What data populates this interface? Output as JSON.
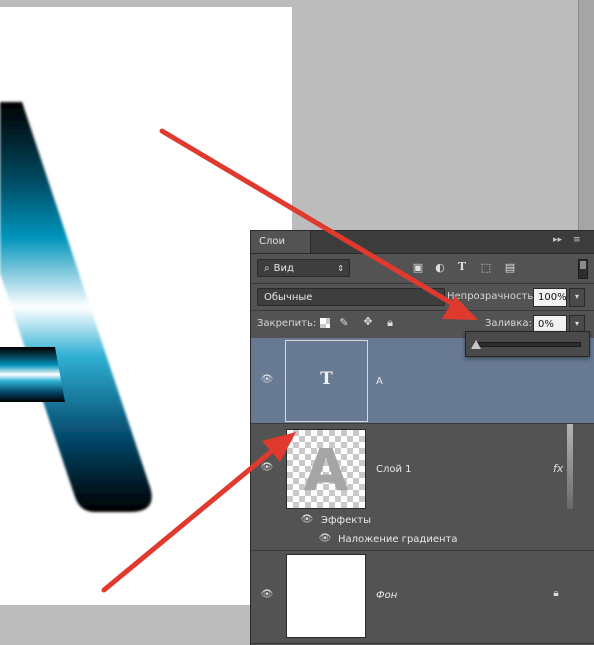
{
  "canvas": {
    "letter_glyph": "A"
  },
  "panel": {
    "tab_label": "Слои",
    "tab_controls": {
      "collapse": "▸▸",
      "menu": "≡"
    },
    "filter": {
      "label": "Вид",
      "icons": [
        "image-icon",
        "adjustment-icon",
        "type-icon",
        "shape-icon",
        "smart-object-icon"
      ]
    },
    "blend_mode": "Обычные",
    "opacity": {
      "label": "Непрозрачность:",
      "value": "100%"
    },
    "lock": {
      "label": "Закрепить:",
      "icons": [
        "lock-transparent-icon",
        "lock-brush-icon",
        "lock-move-icon",
        "lock-all-icon"
      ]
    },
    "fill": {
      "label": "Заливка:",
      "value": "0%",
      "slider_level": 0
    },
    "layers": [
      {
        "name": "A",
        "kind": "text",
        "thumb_glyph": "T",
        "selected": true
      },
      {
        "name": "Слой 1",
        "kind": "raster",
        "thumb_glyph": "A",
        "fx": "fx",
        "effects_label": "Эффекты",
        "effects": [
          "Наложение градиента"
        ]
      },
      {
        "name": "Фон",
        "kind": "background",
        "locked": true
      }
    ]
  },
  "colors": {
    "panel_bg": "#535353",
    "selected_layer": "#687a93",
    "arrow_red": "#e03a2e",
    "gradient": [
      "#000000",
      "#0084a8",
      "#ffffff",
      "#0084a8",
      "#000000"
    ]
  }
}
